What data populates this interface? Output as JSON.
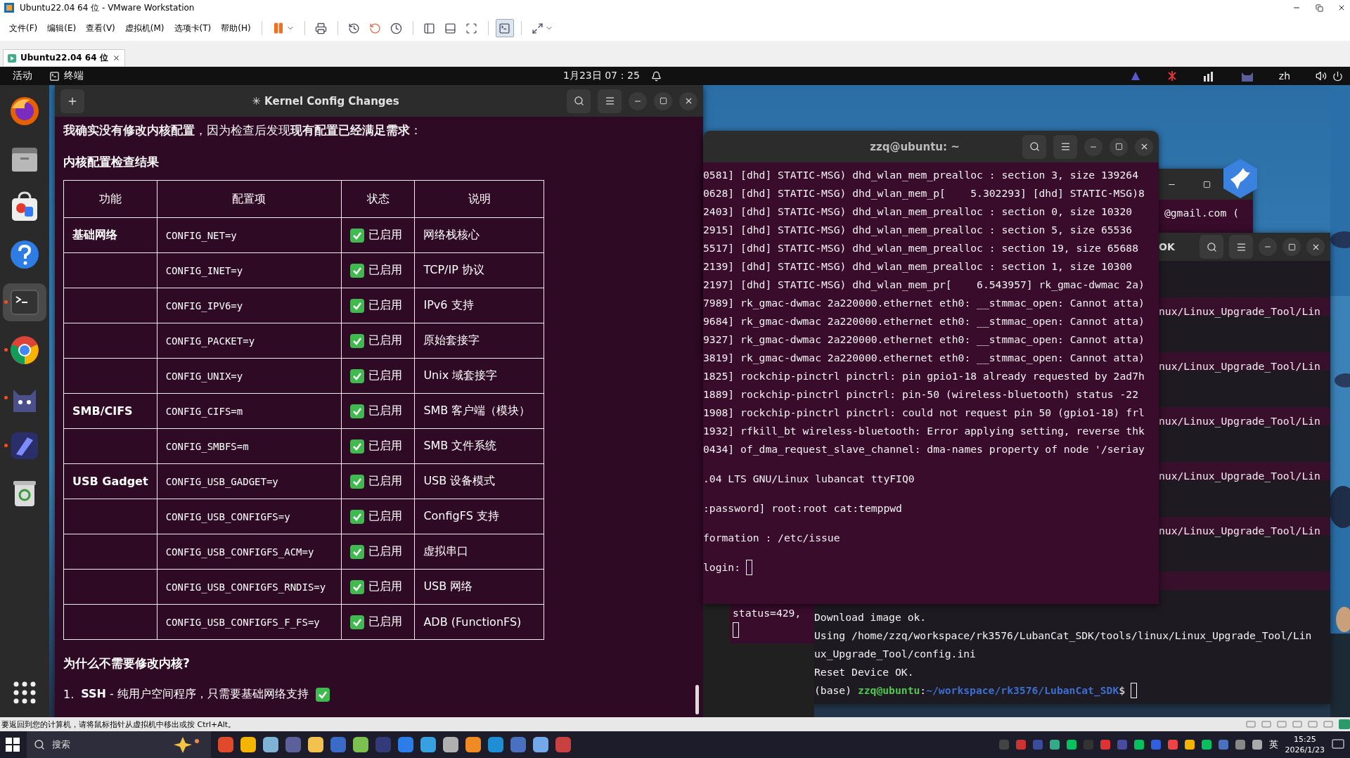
{
  "vmware": {
    "title": "Ubuntu22.04 64 位 - VMware Workstation",
    "menu": [
      "文件(F)",
      "编辑(E)",
      "查看(V)",
      "虚拟机(M)",
      "选项卡(T)",
      "帮助(H)"
    ],
    "tab": {
      "label": "Ubuntu22.04 64 位",
      "selected": true
    },
    "status_text": "要返回到您的计算机，请将鼠标指针从虚拟机中移出或按 Ctrl+Alt。"
  },
  "topbar": {
    "activities": "活动",
    "app": "终端",
    "clock": "1月23日 07：25",
    "lang": "zh"
  },
  "dock": [
    {
      "kind": "firefox",
      "running": false,
      "selected": false
    },
    {
      "kind": "files",
      "running": false,
      "selected": false
    },
    {
      "kind": "store",
      "running": false,
      "selected": false
    },
    {
      "kind": "help",
      "running": false,
      "selected": false
    },
    {
      "kind": "terminal",
      "running": true,
      "selected": true
    },
    {
      "kind": "chrome",
      "running": true,
      "selected": false
    },
    {
      "kind": "cat",
      "running": true,
      "selected": false
    },
    {
      "kind": "pen",
      "running": true,
      "selected": false
    },
    {
      "kind": "trash",
      "running": false,
      "selected": false
    }
  ],
  "doc_window": {
    "title": "✳ Kernel Config Changes",
    "intro": "**我确实没有修改内核配置**，因为检查后发现**现有配置已经满足需求**：",
    "heading": "内核配置检查结果",
    "table": {
      "columns": [
        "功能",
        "配置项",
        "状态",
        "说明"
      ],
      "rows": [
        {
          "feature": "基础网络",
          "option": "CONFIG_NET=y",
          "enabled": true,
          "status": "已启用",
          "note": "网络栈核心"
        },
        {
          "option": "CONFIG_INET=y",
          "enabled": true,
          "status": "已启用",
          "note": "TCP/IP 协议"
        },
        {
          "option": "CONFIG_IPV6=y",
          "enabled": true,
          "status": "已启用",
          "note": "IPv6 支持"
        },
        {
          "option": "CONFIG_PACKET=y",
          "enabled": true,
          "status": "已启用",
          "note": "原始套接字"
        },
        {
          "option": "CONFIG_UNIX=y",
          "enabled": true,
          "status": "已启用",
          "note": "Unix 域套接字"
        },
        {
          "feature": "SMB/CIFS",
          "option": "CONFIG_CIFS=m",
          "enabled": true,
          "status": "已启用",
          "note": "SMB 客户端（模块）"
        },
        {
          "option": "CONFIG_SMBFS=m",
          "enabled": true,
          "status": "已启用",
          "note": "SMB 文件系统"
        },
        {
          "feature": "USB Gadget",
          "option": "CONFIG_USB_GADGET=y",
          "enabled": true,
          "status": "已启用",
          "note": "USB 设备模式"
        },
        {
          "option": "CONFIG_USB_CONFIGFS=y",
          "enabled": true,
          "status": "已启用",
          "note": "ConfigFS 支持"
        },
        {
          "option": "CONFIG_USB_CONFIGFS_ACM=y",
          "enabled": true,
          "status": "已启用",
          "note": "虚拟串口"
        },
        {
          "option": "CONFIG_USB_CONFIGFS_RNDIS=y",
          "enabled": true,
          "status": "已启用",
          "note": "USB 网络"
        },
        {
          "option": "CONFIG_USB_CONFIGFS_F_FS=y",
          "enabled": true,
          "status": "已启用",
          "note": "ADB (FunctionFS)"
        }
      ]
    },
    "section": "为什么不需要修改内核?",
    "list": [
      {
        "number": "1.",
        "text": "**SSH** - 纯用户空间程序，只需要基础网络支持",
        "checked": true
      }
    ]
  },
  "front_terminal": {
    "title": "zzq@ubuntu: ~",
    "lines": [
      {
        "text": "0581] [dhd] STATIC-MSG) dhd_wlan_mem_prealloc : section 3, size 139264",
        "blank_before": false,
        "cursor": false
      },
      {
        "text": "0628] [dhd] STATIC-MSG) dhd_wlan_mem_p[    5.302293] [dhd] STATIC-MSG)8",
        "blank_before": false,
        "cursor": false
      },
      {
        "text": "2403] [dhd] STATIC-MSG) dhd_wlan_mem_prealloc : section 0, size 10320",
        "blank_before": false,
        "cursor": false
      },
      {
        "text": "2915] [dhd] STATIC-MSG) dhd_wlan_mem_prealloc : section 5, size 65536",
        "blank_before": false,
        "cursor": false
      },
      {
        "text": "5517] [dhd] STATIC-MSG) dhd_wlan_mem_prealloc : section 19, size 65688",
        "blank_before": false,
        "cursor": false
      },
      {
        "text": "2139] [dhd] STATIC-MSG) dhd_wlan_mem_prealloc : section 1, size 10300",
        "blank_before": false,
        "cursor": false
      },
      {
        "text": "2197] [dhd] STATIC-MSG) dhd_wlan_mem_pr[    6.543957] rk_gmac-dwmac 2a)",
        "blank_before": false,
        "cursor": false
      },
      {
        "text": "7989] rk_gmac-dwmac 2a220000.ethernet eth0: __stmmac_open: Cannot atta)",
        "blank_before": false,
        "cursor": false
      },
      {
        "text": "9684] rk_gmac-dwmac 2a220000.ethernet eth0: __stmmac_open: Cannot atta)",
        "blank_before": false,
        "cursor": false
      },
      {
        "text": "9327] rk_gmac-dwmac 2a220000.ethernet eth0: __stmmac_open: Cannot atta)",
        "blank_before": false,
        "cursor": false
      },
      {
        "text": "3819] rk_gmac-dwmac 2a220000.ethernet eth0: __stmmac_open: Cannot atta)",
        "blank_before": false,
        "cursor": false
      },
      {
        "text": "1825] rockchip-pinctrl pinctrl: pin gpio1-18 already requested by 2ad7h",
        "blank_before": false,
        "cursor": false
      },
      {
        "text": "1889] rockchip-pinctrl pinctrl: pin-50 (wireless-bluetooth) status -22",
        "blank_before": false,
        "cursor": false
      },
      {
        "text": "1908] rockchip-pinctrl pinctrl: could not request pin 50 (gpio1-18) frl",
        "blank_before": false,
        "cursor": false
      },
      {
        "text": "1932] rfkill_bt wireless-bluetooth: Error applying setting, reverse thk",
        "blank_before": false,
        "cursor": false
      },
      {
        "text": "0434] of_dma_request_slave_channel: dma-names property of node '/seriay",
        "blank_before": false,
        "cursor": false
      },
      {
        "text": ".04 LTS GNU/Linux lubancat ttyFIQ0",
        "blank_before": true,
        "cursor": false
      },
      {
        "text": ":password] root:root cat:temppwd",
        "blank_before": true,
        "cursor": false
      },
      {
        "text": "formation : /etc/issue",
        "blank_before": true,
        "cursor": false
      },
      {
        "text": "login:",
        "blank_before": true,
        "cursor": true
      }
    ]
  },
  "back_terminal": {
    "line": "@gmail.com ("
  },
  "small_terminal": {
    "line": "status=429,"
  },
  "lower_terminal": {
    "title": "OK",
    "upper_lines": [
      "nux/Linux_Upgrade_Tool/Lin",
      "nux/Linux_Upgrade_Tool/Lin",
      "nux/Linux_Upgrade_Tool/Lin",
      "nux/Linux_Upgrade_Tool/Lin",
      "nux/Linux_Upgrade_Tool/Lin"
    ],
    "lines": [
      "Download image ok.",
      "Using /home/zzq/workspace/rk3576/LubanCat_SDK/tools/linux/Linux_Upgrade_Tool/Lin",
      "ux_Upgrade_Tool/config.ini",
      "Reset Device OK."
    ],
    "prompt": {
      "env": "(base)",
      "user": "zzq@ubuntu",
      "sep": ":",
      "path": "~/workspace/rk3576/LubanCat_SDK",
      "symbol": "$"
    }
  },
  "taskbar": {
    "search": "搜索",
    "ime": "英",
    "time": "15:25",
    "date": "2026/1/23"
  }
}
